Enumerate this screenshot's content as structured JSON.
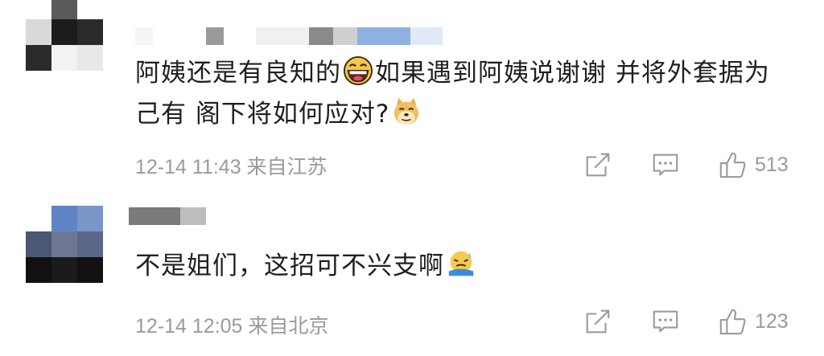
{
  "comments": [
    {
      "content_part1": "阿姨还是有良知的",
      "emoji1": "grin-emoji",
      "content_part2": "如果遇到阿姨说谢谢 并将外套据为己有 阁下将如何应对?",
      "emoji2": "doge-emoji",
      "date": "12-14 11:43",
      "location": "来自江苏",
      "likes": "513"
    },
    {
      "content_part1": "不是姐们，这招可不兴支啊",
      "emoji1": "cold-sweat-emoji",
      "date": "12-14 12:05",
      "location": "来自北京",
      "likes": "123"
    }
  ],
  "icons": [
    "share-icon",
    "comment-icon",
    "like-icon"
  ],
  "colors": {
    "text": "#1f1f1f",
    "meta": "#9a9a9a",
    "icon": "#9a9a9a"
  }
}
